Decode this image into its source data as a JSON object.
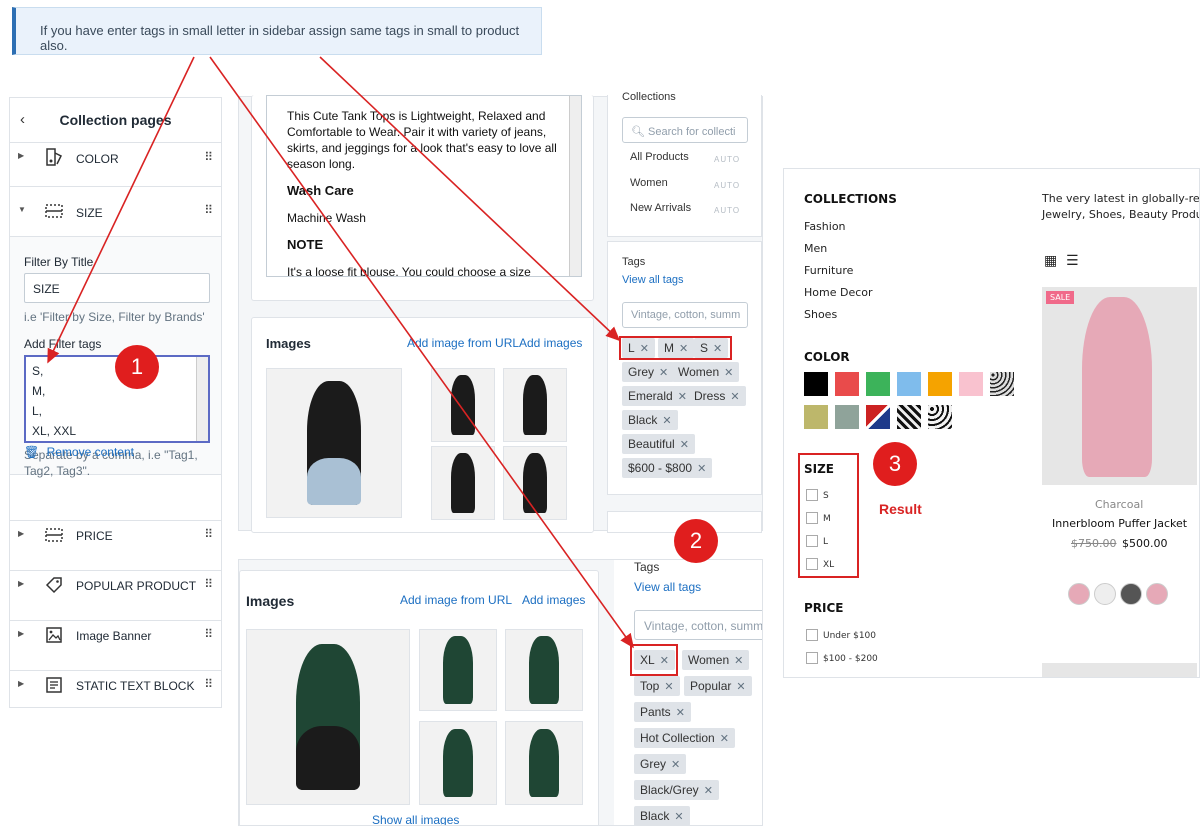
{
  "note": "If you have enter tags in small letter in sidebar assign same tags in small to product also.",
  "sidebar": {
    "title": "Collection pages",
    "back_icon": "chevron-left-icon",
    "items_top": [
      {
        "label": "COLOR",
        "icon": "color-swatch-icon"
      },
      {
        "label": "SIZE",
        "icon": "dashed-box-icon"
      }
    ],
    "filter_by_title_label": "Filter By Title",
    "filter_by_title_value": "SIZE",
    "filter_by_title_hint": "i.e 'Filter by Size, Filter by Brands'",
    "add_filter_tags_label": "Add Filter tags",
    "filter_tags_lines": [
      "S,",
      "M,",
      "L,",
      "XL, XXL"
    ],
    "filter_tags_hint": "Separate by a comma, i.e \"Tag1, Tag2, Tag3\".",
    "remove_content": "Remove content",
    "items_bottom": [
      {
        "label": "PRICE",
        "icon": "dashed-box-icon"
      },
      {
        "label": "POPULAR PRODUCT",
        "icon": "tag-icon"
      },
      {
        "label": "Image Banner",
        "icon": "image-icon"
      },
      {
        "label": "STATIC TEXT BLOCK",
        "icon": "text-block-icon"
      }
    ]
  },
  "product1": {
    "description": {
      "p1": "This Cute Tank Tops is Lightweight, Relaxed and Comfortable to Wear. Pair it with variety of jeans, skirts, and jeggings for a look that's easy to love all season long.",
      "h1": "Wash Care",
      "p2": "Machine Wash",
      "h2": "NOTE",
      "p3": "It's a loose fit blouse. You could choose a size down it"
    },
    "images_title": "Images",
    "add_from_url": "Add image from URL",
    "add_images": "Add images",
    "collections_title": "Collections",
    "search_placeholder": "Search for collecti",
    "collections": [
      {
        "name": "All Products",
        "type": "AUTO"
      },
      {
        "name": "Women",
        "type": "AUTO"
      },
      {
        "name": "New Arrivals",
        "type": "AUTO"
      }
    ],
    "tags_title": "Tags",
    "view_all_tags": "View all tags",
    "tags_placeholder": "Vintage, cotton, summ",
    "tags": [
      "L",
      "M",
      "S",
      "Grey",
      "Women",
      "Emerald",
      "Dress",
      "Black",
      "Beautiful",
      "$600 - $800"
    ]
  },
  "product2": {
    "images_title": "Images",
    "add_from_url": "Add image from URL",
    "add_images": "Add images",
    "show_all_images": "Show all images",
    "tags_title": "Tags",
    "view_all_tags": "View all tags",
    "tags_placeholder": "Vintage, cotton, summ",
    "tags": [
      "XL",
      "Women",
      "Top",
      "Popular",
      "Pants",
      "Hot Collection",
      "Grey",
      "Black/Grey",
      "Black"
    ]
  },
  "result": {
    "label": "Result",
    "collections_title": "COLLECTIONS",
    "collections": [
      "Fashion",
      "Men",
      "Furniture",
      "Home Decor",
      "Shoes"
    ],
    "color_title": "COLOR",
    "colors_row1": [
      "#000000",
      "#e94b4b",
      "#3cb35a",
      "#7fbcec",
      "#f5a300",
      "#f9c2cf",
      "pattern"
    ],
    "colors_row2": [
      "#bdb76b",
      "#8fa39a",
      "flag",
      "pattern",
      "pattern"
    ],
    "size_title": "SIZE",
    "sizes": [
      "S",
      "M",
      "L",
      "XL"
    ],
    "price_title": "PRICE",
    "prices": [
      "Under $100",
      "$100 - $200"
    ],
    "promo_line1": "The very latest in globally-rec",
    "promo_line2": "Jewelry, Shoes, Beauty Produc",
    "grid_icon": "grid-view-icon",
    "list_icon": "list-view-icon",
    "sale_badge": "SALE",
    "product_vendor": "Charcoal",
    "product_name": "Innerbloom Puffer Jacket",
    "old_price": "$750.00",
    "price": "$500.00"
  },
  "badges": [
    "1",
    "2",
    "3"
  ],
  "colors": {
    "accent_red": "#d92323",
    "link_blue": "#1c6fc2",
    "panel_bg": "#f4f6f8"
  }
}
